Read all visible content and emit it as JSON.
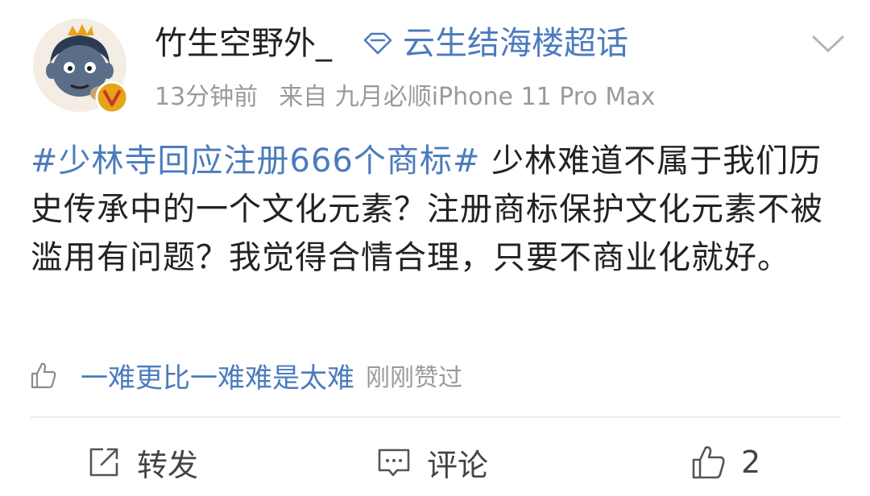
{
  "post": {
    "username": "竹生空野外_",
    "topic": "云生结海楼超话",
    "time": "13分钟前",
    "source": "来自 九月必顺iPhone 11 Pro Max",
    "hashtag": "#少林寺回应注册666个商标#",
    "body_text": " 少林难道不属于我们历史传承中的一个文化元素？注册商标保护文化元素不被滥用有问题？我觉得合情合理，只要不商业化就好。",
    "likes_line": {
      "liker": "一难更比一难难是太难",
      "note": "刚刚赞过"
    }
  },
  "actions": {
    "repost_label": "转发",
    "comment_label": "评论",
    "like_count": "2"
  },
  "colors": {
    "link": "#4c7bbd",
    "meta": "#9a9a9a",
    "text": "#222222",
    "verified": "#e8a317"
  },
  "icons": {
    "avatar": "cartoon-avatar",
    "verified": "verified-v-badge",
    "topic": "diamond-icon",
    "dropdown": "chevron-down-icon",
    "small_like": "thumbs-up-icon",
    "repost": "share-box-icon",
    "comment": "comment-icon",
    "like": "thumbs-up-icon"
  }
}
